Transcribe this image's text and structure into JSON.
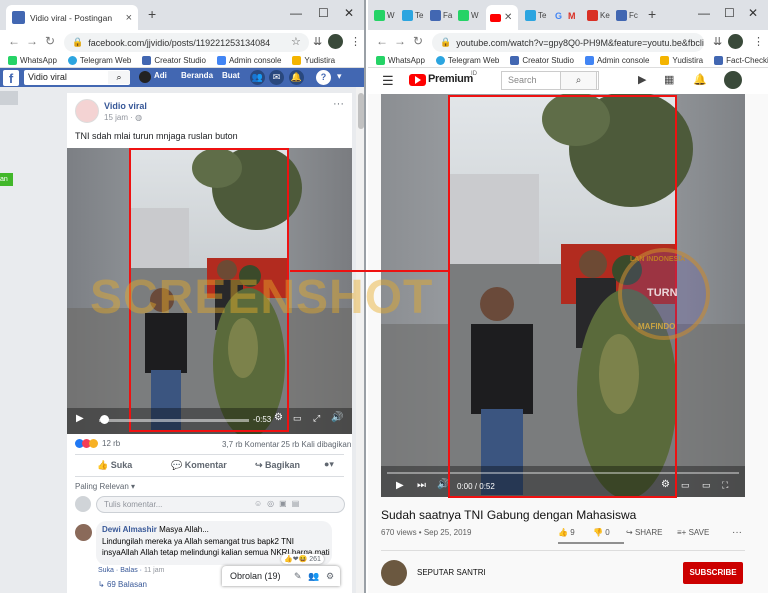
{
  "left": {
    "tab_title": "Vidio viral - Postingan",
    "url": "facebook.com/jjvidio/posts/119221253134084",
    "bookmarks": [
      "WhatsApp",
      "Telegram Web",
      "Creator Studio",
      "Admin console",
      "Yudistira"
    ],
    "fb": {
      "logo": "f",
      "search": "Vidio viral",
      "user": "Adi",
      "home": "Beranda",
      "create": "Buat",
      "side_badge": "an"
    },
    "post": {
      "author": "Vidio viral",
      "time": "15 jam",
      "caption": "TNI sdah mlai turun mnjaga ruslan buton",
      "video_time": "-0:53",
      "reactions": "12 rb",
      "comments": "3,7 rb Komentar",
      "shares": "25 rb Kali dibagikan",
      "like": "Suka",
      "comment": "Komentar",
      "share": "Bagikan",
      "sort": "Paling Relevan",
      "comment_placeholder": "Tulis komentar...",
      "commenter": "Dewi Almashir",
      "comment_text_1": "Masya Allah...",
      "comment_text_2": "Lindungilah mereka ya Allah semangat trus bapk2 TNI",
      "comment_text_3": "insyaAllah Allah tetap melindungi kalian semua NKRI harga mati",
      "comment_reactions": "261",
      "reply_like": "Suka",
      "reply_reply": "Balas",
      "reply_time": "11 jam",
      "replies": "69 Balasan",
      "chat": "Obrolan (19)"
    }
  },
  "right": {
    "url": "youtube.com/watch?v=gpy8Q0-PH9M&feature=youtu.be&fbclid...",
    "tabs": [
      "W",
      "Te",
      "Fa",
      "W",
      "",
      "Te",
      "G",
      "M",
      "Ke",
      "Fc"
    ],
    "bookmarks": [
      "WhatsApp",
      "Telegram Web",
      "Creator Studio",
      "Admin console",
      "Yudistira",
      "Fact-Checking"
    ],
    "yt": {
      "logo": "Premium",
      "search_placeholder": "Search"
    },
    "video": {
      "time": "0:00 / 0:52",
      "title": "Sudah saatnya TNI Gabung dengan Mahasiswa",
      "views": "670 views • Sep 25, 2019",
      "likes": "9",
      "dislikes": "0",
      "share": "SHARE",
      "save": "SAVE",
      "channel": "SEPUTAR SANTRI",
      "subscribe": "SUBSCRIBE"
    }
  },
  "watermark": {
    "text": "SCREENSHOT",
    "left_text": "SCREENSHOT",
    "badge_text": "TURN",
    "badge_top": "LAN INDONESIA",
    "badge_bottom": "MAFINDO"
  },
  "colors": {
    "fb_blue": "#4267b2",
    "yt_red": "#ff0000",
    "highlight": "#e11111"
  }
}
